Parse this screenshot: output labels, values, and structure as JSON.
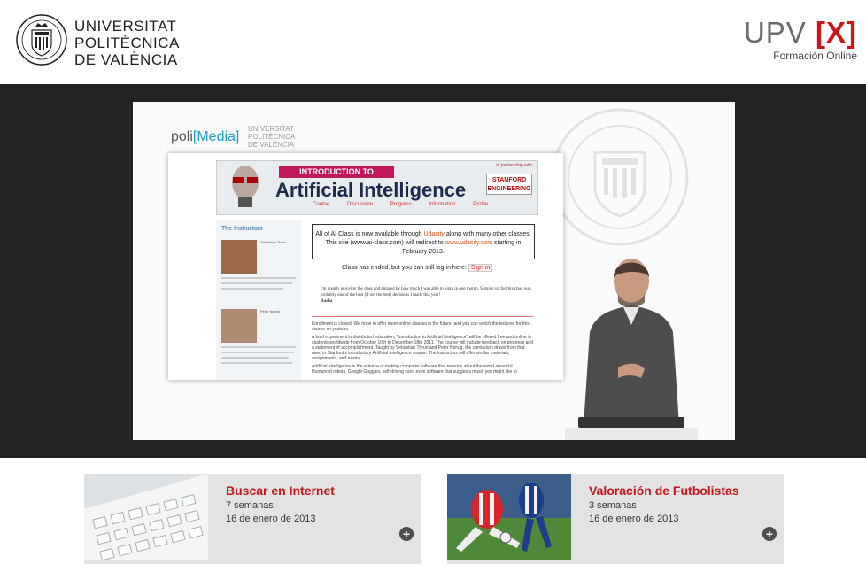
{
  "header": {
    "university_lines": [
      "UNIVERSITAT",
      "POLITÈCNICA",
      "DE VALÈNCIA"
    ],
    "upvx_upv": "UPV",
    "upvx_x": "[X]",
    "upvx_subtitle": "Formación Online"
  },
  "video": {
    "polimedia_poli": "poli",
    "polimedia_media": "[Media]",
    "polimedia_upv_lines": [
      "UNIVERSITAT",
      "POLITÈCNICA",
      "DE VALÈNCIA"
    ],
    "page": {
      "banner_intro": "INTRODUCTION TO",
      "banner_title": "Artificial Intelligence",
      "banner_partner": "in partnership with",
      "stanford": "STANFORD ENGINEERING",
      "nav": [
        "Course",
        "Discussion",
        "Progress",
        "Information",
        "Profile"
      ],
      "side_title": "The Instructors",
      "instructor1": "Sebastian Thrun",
      "instructor2": "Peter Norvig",
      "notice_a": "All of AI Class is now available through",
      "notice_link1": "Udacity",
      "notice_b": "along with many other classes! This site (www.ai-class.com) will redirect to",
      "notice_link2": "www.udacity.com",
      "notice_c": "starting in February 2013.",
      "ended_text": "Class has ended, but you can still log in here:",
      "sign_in": "Sign in",
      "quote": "I'm greatly enjoying the class and amazed by how much I was able to learn in one month. Signing up for this class was probably one of the best (if not the best) decisions I made this year!",
      "quote_author": "Rasha",
      "body_1": "Enrollment is closed. We hope to offer more online classes in the future, and you can watch the lectures for this course on youtube.",
      "body_2": "A bold experiment in distributed education, \"Introduction to Artificial Intelligence\" will be offered free and online to students worldwide from October 10th to December 18th 2011. The course will include feedback on progress and a statement of accomplishment. Taught by Sebastian Thrun and Peter Norvig, the curriculum draws from that used in Stanford's introductory Artificial Intelligence course. The instructors will offer similar materials, assignments, and exams.",
      "body_3": "Artificial Intelligence is the science of making computer software that reasons about the world around it. Humanoid robots, Google Goggles, self-driving cars, even software that suggests music you might like to"
    }
  },
  "courses": [
    {
      "title": "Buscar en Internet",
      "duration": "7 semanas",
      "date": "16 de enero de 2013",
      "plus": "+"
    },
    {
      "title": "Valoración de Futbolistas",
      "duration": "3 semanas",
      "date": "16 de enero de 2013",
      "plus": "+"
    }
  ],
  "colors": {
    "accent_red": "#c0181c",
    "stage_bg": "#232323",
    "card_bg": "#e3e3e3"
  }
}
